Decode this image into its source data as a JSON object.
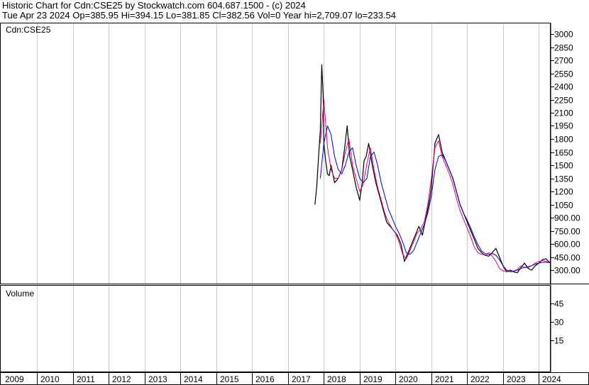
{
  "header": {
    "title_line": "Historic Chart for Cdn:CSE25 by Stockwatch.com 604.687.1500 - (c) 2024",
    "quote_line": "Tue Apr 23 2024   Op=385.95   Hi=394.15   Lo=381.85   Cl=382.56   Vol=0   Year hi=2,709.07   lo=233.54"
  },
  "chart_data": {
    "type": "line",
    "symbol_label": "Cdn:CSE25",
    "volume_label": "Volume",
    "price_axis": {
      "min": 300,
      "max": 3000,
      "ticks": [
        "3000",
        "2850",
        "2700",
        "2550",
        "2400",
        "2250",
        "2100",
        "1950",
        "1800",
        "1650",
        "1500",
        "1350",
        "1200",
        "1050",
        "900.00",
        "750.00",
        "600.00",
        "450.00",
        "300.00"
      ]
    },
    "volume_axis": {
      "ticks": [
        "45",
        "30",
        "15"
      ]
    },
    "x_axis": {
      "years": [
        "2009",
        "2010",
        "2011",
        "2012",
        "2013",
        "2014",
        "2015",
        "2016",
        "2017",
        "2018",
        "2019",
        "2020",
        "2021",
        "2022",
        "2023",
        "2024"
      ]
    },
    "grid": true,
    "series": [
      {
        "color": "#000000",
        "x": [
          2017.75,
          2017.8,
          2017.86,
          2017.9,
          2017.94,
          2017.98,
          2018.0,
          2018.05,
          2018.1,
          2018.15,
          2018.2,
          2018.3,
          2018.4,
          2018.5,
          2018.58,
          2018.65,
          2018.72,
          2018.8,
          2018.9,
          2019.0,
          2019.07,
          2019.12,
          2019.18,
          2019.25,
          2019.35,
          2019.45,
          2019.55,
          2019.65,
          2019.75,
          2019.85,
          2019.95,
          2020.05,
          2020.15,
          2020.2,
          2020.25,
          2020.3,
          2020.35,
          2020.45,
          2020.55,
          2020.65,
          2020.75,
          2020.85,
          2020.95,
          2021.0,
          2021.05,
          2021.1,
          2021.2,
          2021.3,
          2021.4,
          2021.5,
          2021.6,
          2021.7,
          2021.8,
          2021.9,
          2022.0,
          2022.1,
          2022.2,
          2022.3,
          2022.4,
          2022.5,
          2022.6,
          2022.7,
          2022.8,
          2022.9,
          2023.0,
          2023.1,
          2023.2,
          2023.3,
          2023.4,
          2023.5,
          2023.6,
          2023.7,
          2023.8,
          2023.9,
          2024.0,
          2024.1,
          2024.2,
          2024.31
        ],
        "y": [
          1050,
          1250,
          1650,
          1900,
          2650,
          2300,
          1750,
          1550,
          1400,
          1380,
          1500,
          1300,
          1350,
          1450,
          1700,
          1950,
          1600,
          1450,
          1250,
          1100,
          1300,
          1550,
          1600,
          1750,
          1500,
          1300,
          1150,
          1000,
          850,
          800,
          750,
          700,
          600,
          500,
          400,
          450,
          500,
          600,
          700,
          800,
          700,
          900,
          1100,
          1250,
          1500,
          1750,
          1850,
          1650,
          1550,
          1450,
          1350,
          1200,
          1050,
          950,
          850,
          750,
          650,
          550,
          500,
          470,
          460,
          500,
          550,
          450,
          350,
          280,
          300,
          280,
          270,
          330,
          380,
          320,
          300,
          350,
          380,
          420,
          430,
          383
        ]
      },
      {
        "color": "#e0007a",
        "x": [
          2017.9,
          2018.0,
          2018.1,
          2018.2,
          2018.3,
          2018.4,
          2018.5,
          2018.6,
          2018.7,
          2018.8,
          2018.9,
          2019.0,
          2019.1,
          2019.2,
          2019.3,
          2019.4,
          2019.5,
          2019.6,
          2019.7,
          2019.8,
          2019.9,
          2020.0,
          2020.1,
          2020.2,
          2020.3,
          2020.4,
          2020.5,
          2020.6,
          2020.7,
          2020.8,
          2020.9,
          2021.0,
          2021.1,
          2021.2,
          2021.3,
          2021.4,
          2021.5,
          2021.6,
          2021.7,
          2021.8,
          2021.9,
          2022.0,
          2022.1,
          2022.2,
          2022.3,
          2022.4,
          2022.5,
          2022.6,
          2022.7,
          2022.8,
          2022.9,
          2023.0,
          2023.1,
          2023.2,
          2023.3,
          2023.4,
          2023.5,
          2023.6,
          2023.7,
          2023.8,
          2023.9,
          2024.0,
          2024.1,
          2024.2,
          2024.31
        ],
        "y": [
          1750,
          2250,
          1700,
          1450,
          1350,
          1350,
          1450,
          1650,
          1800,
          1500,
          1350,
          1200,
          1280,
          1520,
          1700,
          1450,
          1250,
          1100,
          950,
          850,
          780,
          720,
          620,
          480,
          430,
          520,
          620,
          720,
          770,
          850,
          1050,
          1350,
          1700,
          1780,
          1600,
          1500,
          1400,
          1280,
          1120,
          980,
          880,
          780,
          680,
          560,
          500,
          480,
          470,
          500,
          460,
          400,
          320,
          290,
          290,
          280,
          285,
          310,
          350,
          330,
          330,
          350,
          380,
          400,
          410,
          400,
          385
        ]
      },
      {
        "color": "#0000cc",
        "x": [
          2017.9,
          2018.0,
          2018.1,
          2018.2,
          2018.3,
          2018.4,
          2018.5,
          2018.6,
          2018.7,
          2018.8,
          2018.9,
          2019.0,
          2019.1,
          2019.2,
          2019.3,
          2019.4,
          2019.5,
          2019.6,
          2019.7,
          2019.8,
          2019.9,
          2020.0,
          2020.1,
          2020.2,
          2020.3,
          2020.4,
          2020.5,
          2020.6,
          2020.7,
          2020.8,
          2020.9,
          2021.0,
          2021.1,
          2021.2,
          2021.3,
          2021.4,
          2021.5,
          2021.6,
          2021.7,
          2021.8,
          2021.9,
          2022.0,
          2022.1,
          2022.2,
          2022.3,
          2022.4,
          2022.5,
          2022.6,
          2022.7,
          2022.8,
          2022.9,
          2023.0,
          2023.1,
          2023.2,
          2023.3,
          2023.4,
          2023.5,
          2023.6,
          2023.7,
          2023.8,
          2023.9,
          2024.0,
          2024.1,
          2024.2,
          2024.31
        ],
        "y": [
          1350,
          1750,
          1950,
          1850,
          1600,
          1450,
          1400,
          1500,
          1650,
          1700,
          1500,
          1350,
          1300,
          1350,
          1600,
          1650,
          1500,
          1300,
          1150,
          1000,
          900,
          800,
          720,
          620,
          500,
          480,
          520,
          620,
          720,
          820,
          950,
          1150,
          1450,
          1600,
          1620,
          1550,
          1450,
          1350,
          1200,
          1050,
          950,
          870,
          780,
          680,
          590,
          520,
          490,
          480,
          490,
          470,
          420,
          350,
          300,
          290,
          290,
          300,
          320,
          330,
          340,
          350,
          370,
          380,
          390,
          390,
          385
        ]
      }
    ]
  }
}
